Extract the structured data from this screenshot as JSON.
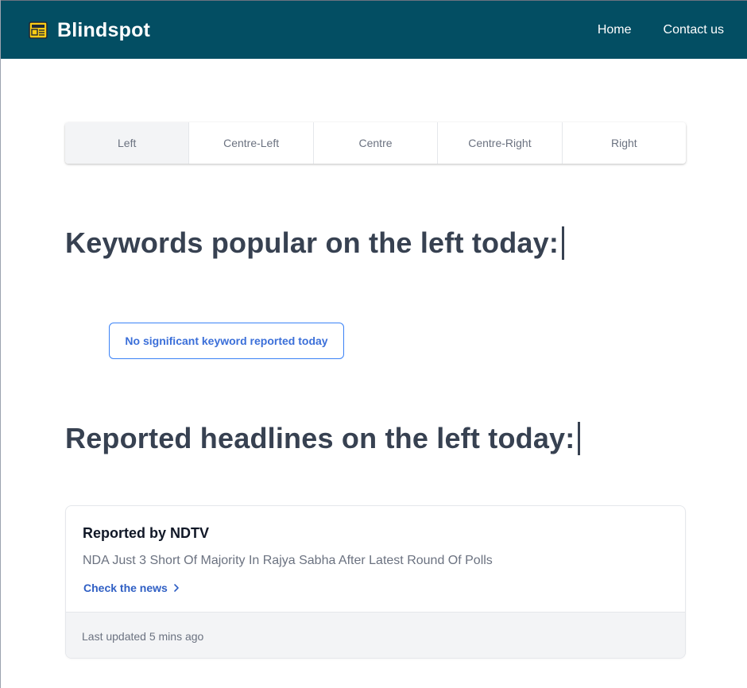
{
  "nav": {
    "brand": "Blindspot",
    "brand_icon": "newspaper-icon",
    "links": [
      "Home",
      "Contact us"
    ],
    "background": "#034e63"
  },
  "tabs": [
    "Left",
    "Centre-Left",
    "Centre",
    "Centre-Right",
    "Right"
  ],
  "selected_tab": "Left",
  "keywords_heading": "Keywords popular on the left today:",
  "keyword_badge": "No significant keyword reported today",
  "headlines_heading": "Reported headlines on the left today:",
  "card": {
    "title": "Reported by NDTV",
    "headline": "NDA Just 3 Short Of Majority In Rajya Sabha After Latest Round Of Polls",
    "link_label": "Check the news",
    "link_icon": "chevron-right-icon",
    "updated": "Last updated 5 mins ago"
  },
  "colors": {
    "accent": "#3b82f6",
    "link": "#2f5fc4",
    "heading": "#374151"
  }
}
